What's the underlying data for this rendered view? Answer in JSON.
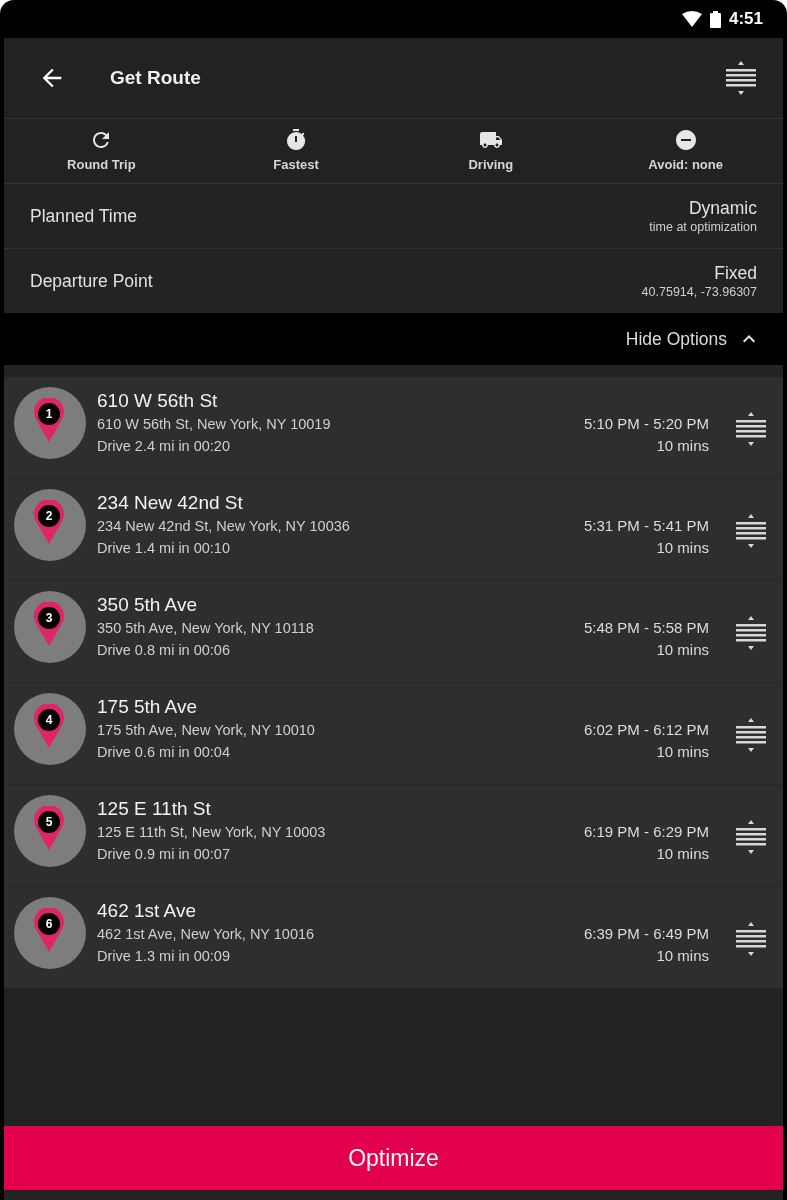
{
  "status_bar": {
    "time": "4:51"
  },
  "app_bar": {
    "title": "Get Route"
  },
  "route_options": [
    {
      "kind": "round_trip",
      "label": "Round Trip"
    },
    {
      "kind": "fastest",
      "label": "Fastest"
    },
    {
      "kind": "driving",
      "label": "Driving"
    },
    {
      "kind": "avoid",
      "label": "Avoid: none"
    }
  ],
  "settings": [
    {
      "label": "Planned Time",
      "value": "Dynamic",
      "detail": "time at optimization"
    },
    {
      "label": "Departure Point",
      "value": "Fixed",
      "detail": "40.75914, -73.96307"
    }
  ],
  "options_toggle": {
    "label": "Hide Options",
    "expanded": true
  },
  "stops": [
    {
      "number": "1",
      "name": "610 W 56th St",
      "address": "610 W 56th St, New York, NY 10019",
      "drive": "Drive 2.4 mi in 00:20",
      "time_window": "5:10 PM - 5:20 PM",
      "duration": "10 mins"
    },
    {
      "number": "2",
      "name": "234 New 42nd St",
      "address": "234 New 42nd St, New York, NY 10036",
      "drive": "Drive 1.4 mi in 00:10",
      "time_window": "5:31 PM - 5:41 PM",
      "duration": "10 mins"
    },
    {
      "number": "3",
      "name": "350 5th Ave",
      "address": "350 5th Ave, New York, NY 10118",
      "drive": "Drive 0.8 mi in 00:06",
      "time_window": "5:48 PM - 5:58 PM",
      "duration": "10 mins"
    },
    {
      "number": "4",
      "name": "175 5th Ave",
      "address": "175 5th Ave, New York, NY 10010",
      "drive": "Drive 0.6 mi in 00:04",
      "time_window": "6:02 PM - 6:12 PM",
      "duration": "10 mins"
    },
    {
      "number": "5",
      "name": "125 E 11th St",
      "address": "125 E 11th St, New York, NY 10003",
      "drive": "Drive 0.9 mi in 00:07",
      "time_window": "6:19 PM - 6:29 PM",
      "duration": "10 mins"
    },
    {
      "number": "6",
      "name": "462 1st Ave",
      "address": "462 1st Ave, New York, NY 10016",
      "drive": "Drive 1.3 mi in 00:09",
      "time_window": "6:39 PM - 6:49 PM",
      "duration": "10 mins"
    }
  ],
  "primary_button": {
    "label": "Optimize"
  }
}
